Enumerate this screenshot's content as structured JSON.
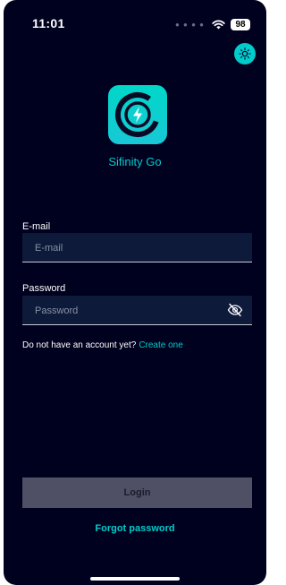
{
  "status_bar": {
    "time": "11:01",
    "signal_icon": "signal-dots",
    "wifi_icon": "wifi-icon",
    "battery_level": "98"
  },
  "header": {
    "theme_toggle_icon": "sun-icon"
  },
  "app": {
    "logo_icon": "sifinity-bolt-logo",
    "name": "Sifinity Go"
  },
  "form": {
    "email_label": "E-mail",
    "email_placeholder": "E-mail",
    "email_value": "",
    "password_label": "Password",
    "password_placeholder": "Password",
    "password_value": "",
    "visibility_icon": "eye-off-icon"
  },
  "signup": {
    "prompt": "Do not have an account yet?",
    "link": "Create one"
  },
  "actions": {
    "login_label": "Login",
    "forgot_label": "Forgot password"
  },
  "colors": {
    "background": "#00001f",
    "accent": "#00cccc",
    "field_bg": "#0d1a3a",
    "button_disabled": "#4f4f66"
  }
}
